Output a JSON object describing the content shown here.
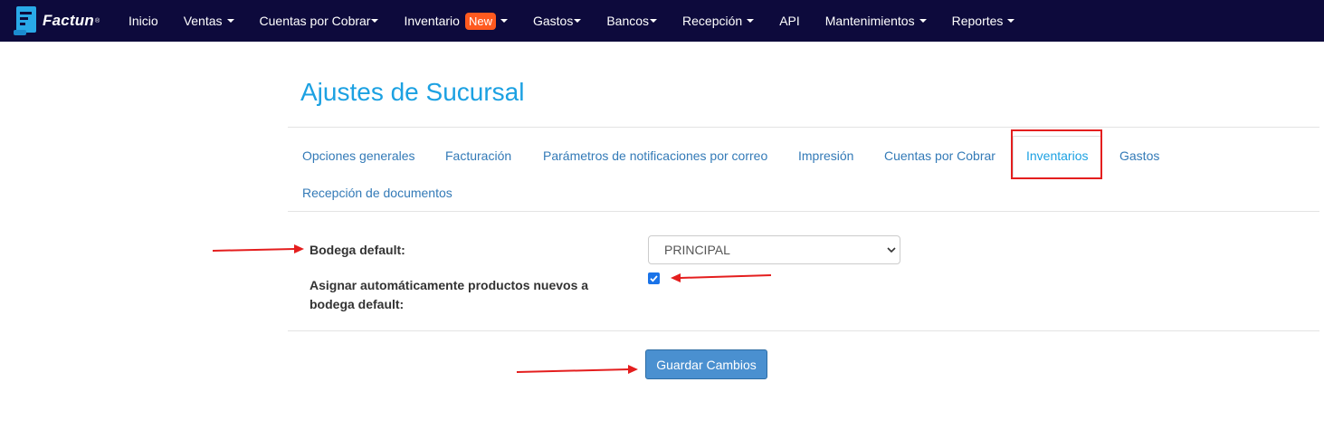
{
  "app": {
    "brand_name": "Factun",
    "brand_reg": "®"
  },
  "nav": {
    "items": [
      {
        "label": "Inicio",
        "dropdown": false
      },
      {
        "label": "Ventas",
        "dropdown": true
      },
      {
        "label": "Cuentas por Cobrar",
        "dropdown": true
      },
      {
        "label": "Inventario",
        "dropdown": true,
        "badge": "New"
      },
      {
        "label": "Gastos",
        "dropdown": true
      },
      {
        "label": "Bancos",
        "dropdown": true
      },
      {
        "label": "Recepción",
        "dropdown": true
      },
      {
        "label": "API",
        "dropdown": false
      },
      {
        "label": "Mantenimientos",
        "dropdown": true
      },
      {
        "label": "Reportes",
        "dropdown": true
      }
    ]
  },
  "page": {
    "title": "Ajustes de Sucursal"
  },
  "tabs": [
    {
      "label": "Opciones generales",
      "active": false
    },
    {
      "label": "Facturación",
      "active": false
    },
    {
      "label": "Parámetros de notificaciones por correo",
      "active": false
    },
    {
      "label": "Impresión",
      "active": false
    },
    {
      "label": "Cuentas por Cobrar",
      "active": false
    },
    {
      "label": "Inventarios",
      "active": true
    },
    {
      "label": "Gastos",
      "active": false
    },
    {
      "label": "Recepción de documentos",
      "active": false
    }
  ],
  "form": {
    "bodega_label": "Bodega default:",
    "bodega_value": "PRINCIPAL",
    "auto_assign_label_line1": "Asignar automáticamente productos nuevos a",
    "auto_assign_label_line2": "bodega default:",
    "auto_assign_checked": true,
    "save_label": "Guardar Cambios"
  },
  "colors": {
    "navbar_bg": "#0d0a3c",
    "title": "#1ca1e2",
    "link": "#337ab7",
    "badge": "#ff5a1f",
    "button": "#4a90d0",
    "annotation": "#e41e1e"
  }
}
